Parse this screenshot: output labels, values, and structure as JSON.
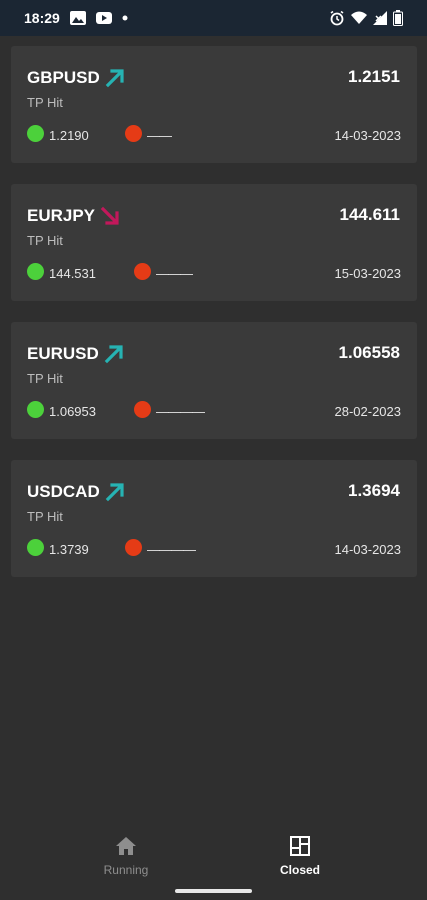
{
  "status_bar": {
    "time": "18:29",
    "icons": [
      "gallery-icon",
      "youtube-icon",
      "dot-icon",
      "alarm-icon",
      "wifi-icon",
      "signal-icon",
      "battery-icon"
    ]
  },
  "signals": [
    {
      "pair": "GBPUSD",
      "direction": "up",
      "price": "1.2151",
      "status": "TP Hit",
      "tp": "1.2190",
      "sl": "——",
      "date": "14-03-2023"
    },
    {
      "pair": "EURJPY",
      "direction": "down",
      "price": "144.611",
      "status": "TP Hit",
      "tp": "144.531",
      "sl": "———",
      "date": "15-03-2023"
    },
    {
      "pair": "EURUSD",
      "direction": "up",
      "price": "1.06558",
      "status": "TP Hit",
      "tp": "1.06953",
      "sl": "————",
      "date": "28-02-2023"
    },
    {
      "pair": "USDCAD",
      "direction": "up",
      "price": "1.3694",
      "status": "TP Hit",
      "tp": "1.3739",
      "sl": "————",
      "date": "14-03-2023"
    }
  ],
  "nav": {
    "running_label": "Running",
    "closed_label": "Closed",
    "active": "closed"
  },
  "colors": {
    "up_arrow": "#26b3b3",
    "down_arrow": "#c2185b",
    "tp_dot": "#4cd13b",
    "sl_dot": "#e53b16"
  }
}
